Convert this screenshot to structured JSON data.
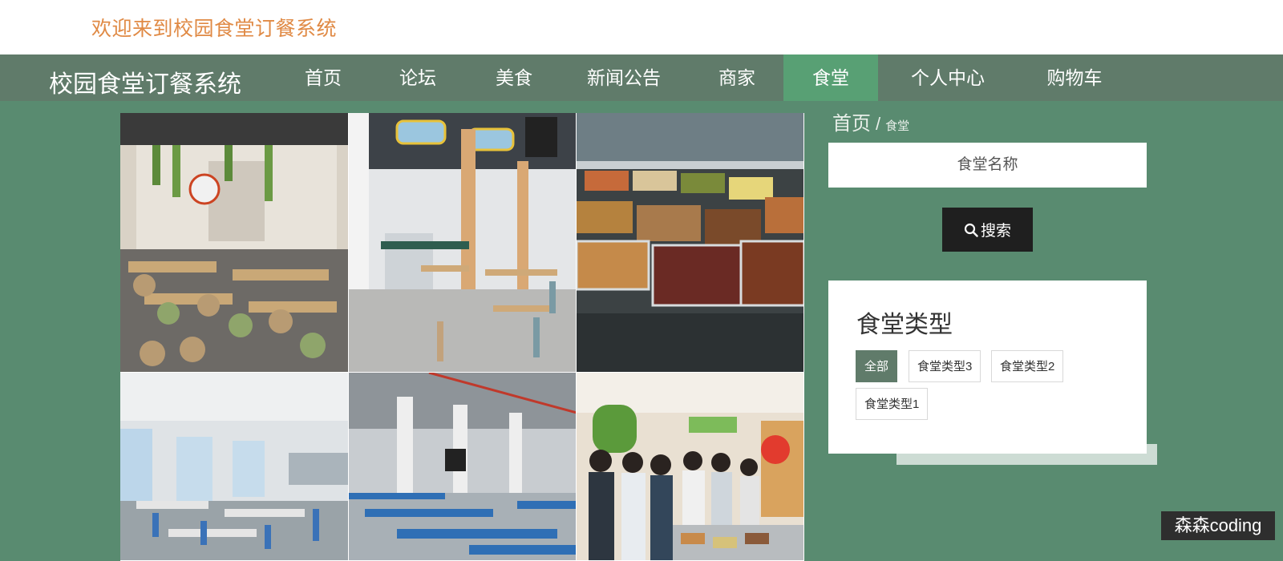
{
  "header": {
    "welcome": "欢迎来到校园食堂订餐系统"
  },
  "nav": {
    "brand": "校园食堂订餐系统",
    "items": [
      {
        "label": "首页"
      },
      {
        "label": "论坛"
      },
      {
        "label": "美食"
      },
      {
        "label": "新闻公告"
      },
      {
        "label": "商家"
      },
      {
        "label": "食堂",
        "active": true
      },
      {
        "label": "个人中心"
      },
      {
        "label": "购物车"
      }
    ]
  },
  "breadcrumb": {
    "home": "首页",
    "separator": "/",
    "current": "食堂"
  },
  "search": {
    "placeholder": "食堂名称",
    "button_label": "搜索"
  },
  "type_panel": {
    "title": "食堂类型",
    "tags": [
      {
        "label": "全部",
        "active": true
      },
      {
        "label": "食堂类型3"
      },
      {
        "label": "食堂类型2"
      },
      {
        "label": "食堂类型1"
      }
    ]
  },
  "watermark": "森森coding",
  "colors": {
    "nav_bg": "#607b6a",
    "nav_active": "#58a074",
    "page_bg": "#598b70",
    "welcome_text": "#e08a45"
  }
}
